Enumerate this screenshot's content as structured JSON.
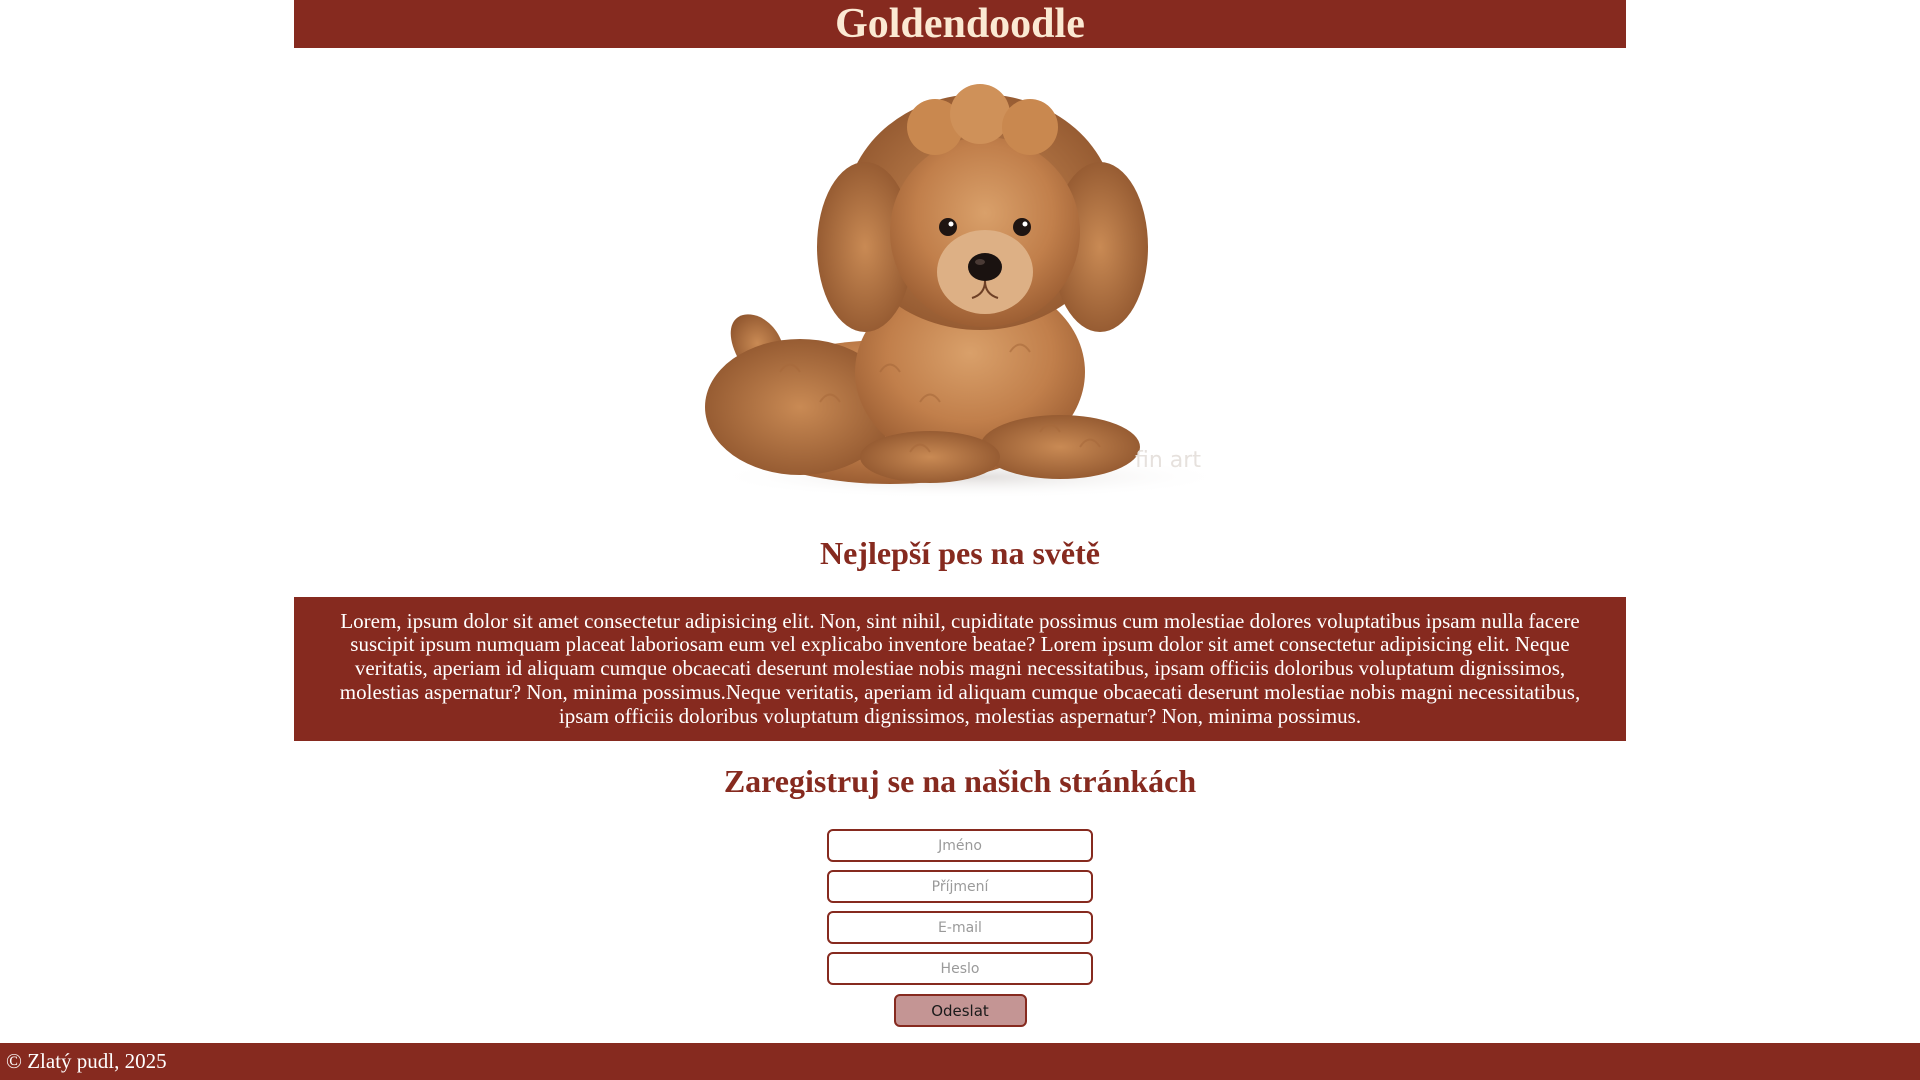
{
  "header": {
    "title": "Goldendoodle"
  },
  "hero": {
    "alt": "Goldendoodle puppy",
    "watermark": "fin art"
  },
  "intro": {
    "title": "Nejlepší pes na světě",
    "text": "Lorem, ipsum dolor sit amet consectetur adipisicing elit. Non, sint nihil, cupiditate possimus cum molestiae dolores voluptatibus ipsam nulla facere suscipit ipsum numquam placeat laboriosam eum vel explicabo inventore beatae? Lorem ipsum dolor sit amet consectetur adipisicing elit. Neque veritatis, aperiam id aliquam cumque obcaecati deserunt molestiae nobis magni necessitatibus, ipsam officiis doloribus voluptatum dignissimos, molestias aspernatur? Non, minima possimus.Neque veritatis, aperiam id aliquam cumque obcaecati deserunt molestiae nobis magni necessitatibus, ipsam officiis doloribus voluptatum dignissimos, molestias aspernatur? Non, minima possimus."
  },
  "register": {
    "title": "Zaregistruj se na našich stránkách",
    "fields": {
      "first_name": {
        "placeholder": "Jméno",
        "value": ""
      },
      "last_name": {
        "placeholder": "Příjmení",
        "value": ""
      },
      "email": {
        "placeholder": "E-mail",
        "value": ""
      },
      "password": {
        "placeholder": "Heslo",
        "value": ""
      }
    },
    "submit_label": "Odeslat"
  },
  "footer": {
    "text": "© Zlatý pudl, 2025"
  },
  "colors": {
    "brand": "#862a1f",
    "header_text": "#fbe9d3",
    "button_bg": "#c49594"
  }
}
